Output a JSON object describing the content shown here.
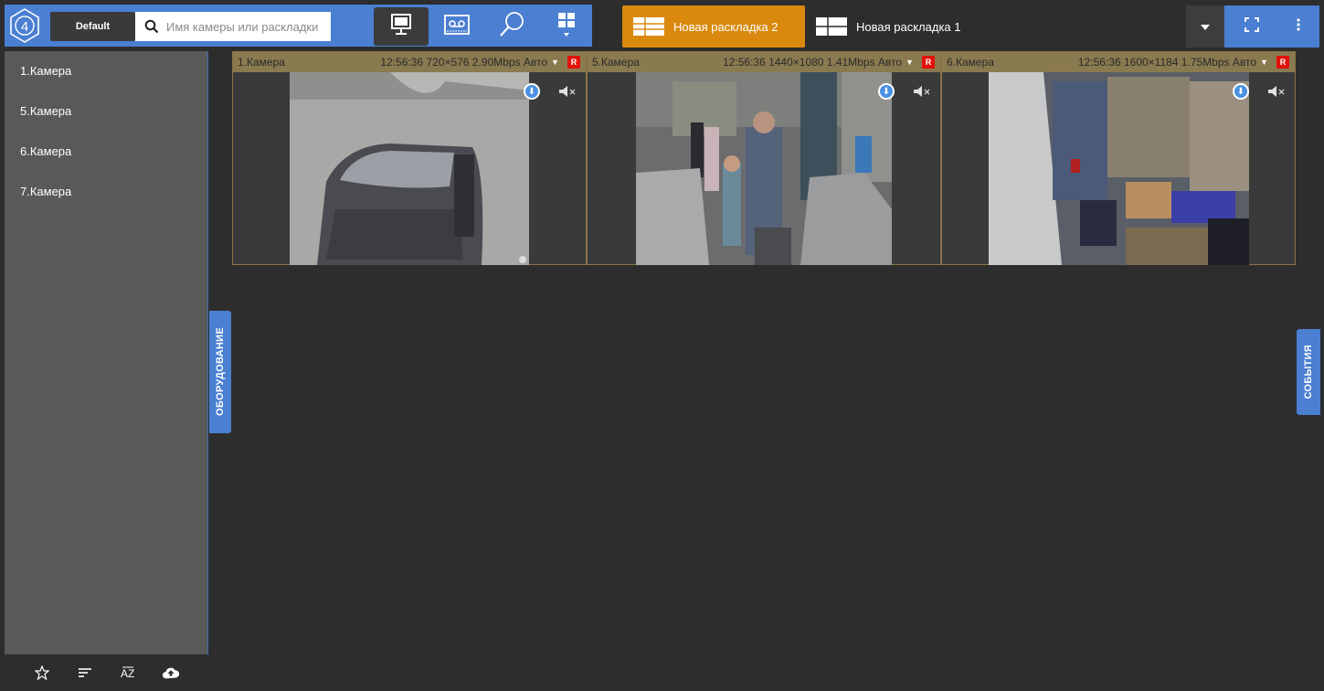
{
  "app": {
    "logo_glyph": "4",
    "profile_label": "Default",
    "search": {
      "placeholder": "Имя камеры или раскладки"
    }
  },
  "modes": [
    {
      "name": "live",
      "icon": "monitor-icon",
      "active": true
    },
    {
      "name": "archive",
      "icon": "tape-icon",
      "active": false
    },
    {
      "name": "search",
      "icon": "magnifier-icon",
      "active": false
    },
    {
      "name": "layouts",
      "icon": "grid-icon",
      "active": false
    }
  ],
  "layout_tabs": [
    {
      "label": "Новая раскладка 2",
      "active": true
    },
    {
      "label": "Новая раскладка 1",
      "active": false
    }
  ],
  "sidebar": {
    "cameras": [
      {
        "label": "1.Камера"
      },
      {
        "label": "5.Камера"
      },
      {
        "label": "6.Камера"
      },
      {
        "label": "7.Камера"
      }
    ],
    "bottom_icons": [
      "star-icon",
      "sort-icon",
      "az-sort-icon",
      "cloud-upload-icon"
    ]
  },
  "side_tabs": {
    "left": "ОБОРУДОВАНИЕ",
    "right": "СОБЫТИЯ"
  },
  "tiles": [
    {
      "name": "1.Камера",
      "info": "12:56:36  720×576 2.90Mbps Авто",
      "rec": "R"
    },
    {
      "name": "5.Камера",
      "info": "12:56:36  1440×1080 1.41Mbps Авто",
      "rec": "R"
    },
    {
      "name": "6.Камера",
      "info": "12:56:36  1600×1184 1.75Mbps Авто",
      "rec": "R"
    }
  ],
  "colors": {
    "accent_blue": "#4a7fd1",
    "active_tab_orange": "#d98a0e",
    "tile_header": "#8a7a50",
    "rec_red": "#e3120b"
  }
}
